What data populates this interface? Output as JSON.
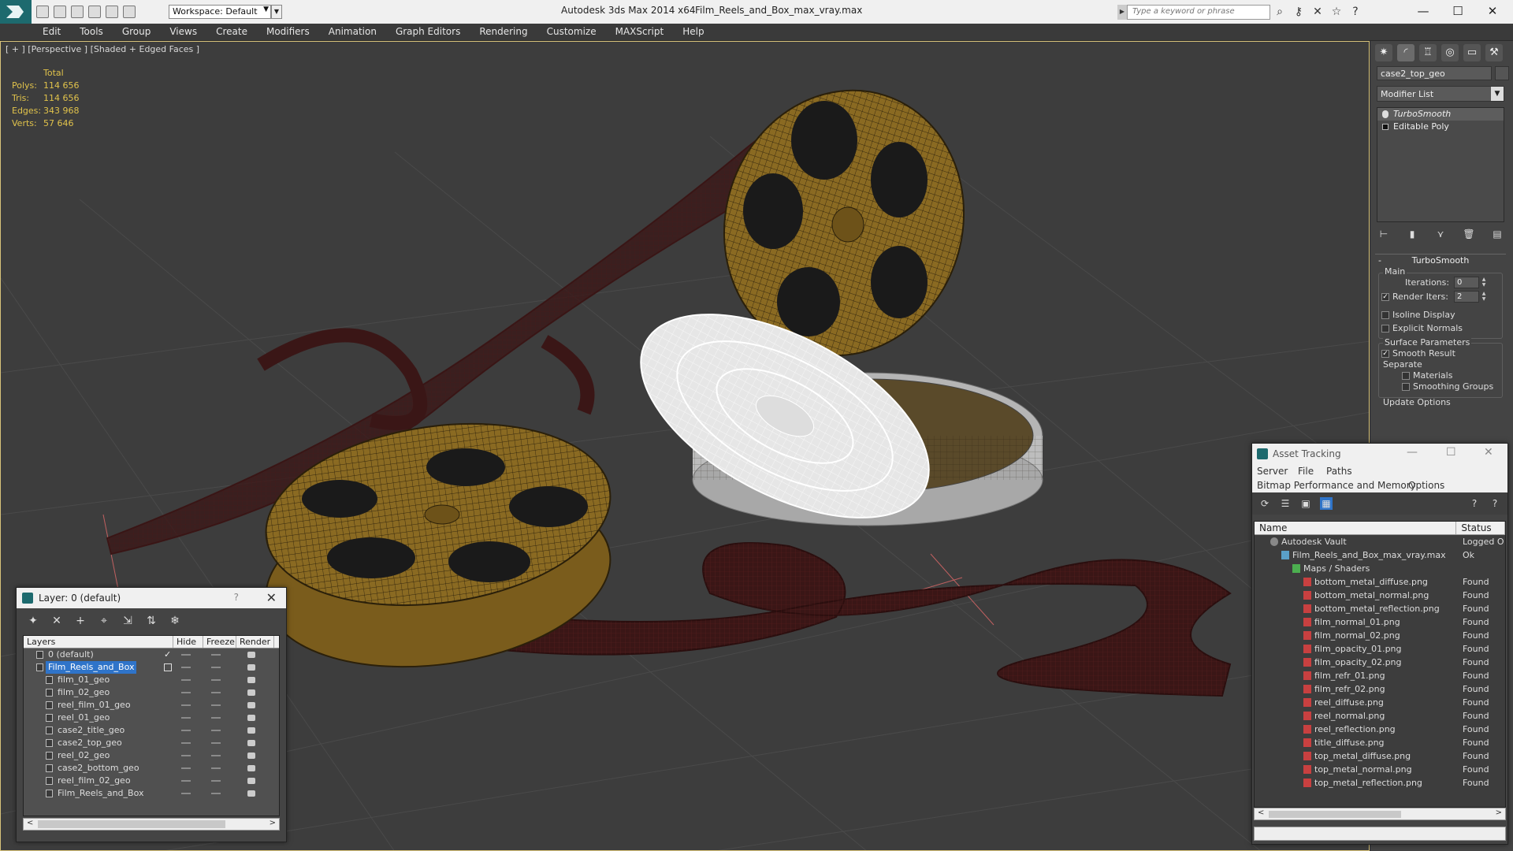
{
  "titlebar": {
    "workspace": "Workspace: Default",
    "app_name": "Autodesk 3ds Max  2014 x64",
    "file_name": "Film_Reels_and_Box_max_vray.max",
    "search_placeholder": "Type a keyword or phrase"
  },
  "menu": [
    "Edit",
    "Tools",
    "Group",
    "Views",
    "Create",
    "Modifiers",
    "Animation",
    "Graph Editors",
    "Rendering",
    "Customize",
    "MAXScript",
    "Help"
  ],
  "viewport": {
    "label": "[ + ] [Perspective ] [Shaded + Edged Faces ]",
    "stats": {
      "header": "Total",
      "rows": [
        {
          "label": "Polys:",
          "value": "114 656"
        },
        {
          "label": "Tris:",
          "value": "114 656"
        },
        {
          "label": "Edges:",
          "value": "343 968"
        },
        {
          "label": "Verts:",
          "value": "57 646"
        }
      ]
    }
  },
  "command_panel": {
    "object_name": "case2_top_geo",
    "modifier_list": "Modifier List",
    "stack": [
      "TurboSmooth",
      "Editable Poly"
    ],
    "rollout_title": "TurboSmooth",
    "main_label": "Main",
    "iterations_label": "Iterations:",
    "iterations_value": "0",
    "render_iters_label": "Render Iters:",
    "render_iters_value": "2",
    "isoline_label": "Isoline Display",
    "explicit_normals_label": "Explicit Normals",
    "surface_params_label": "Surface Parameters",
    "smooth_result_label": "Smooth Result",
    "separate_label": "Separate",
    "materials_label": "Materials",
    "smoothing_groups_label": "Smoothing Groups",
    "update_options_label": "Update Options"
  },
  "layer_dialog": {
    "title": "Layer: 0 (default)",
    "help": "?",
    "columns": [
      "Layers",
      "Hide",
      "Freeze",
      "Render"
    ],
    "rows": [
      {
        "name": "0 (default)",
        "indent": 1,
        "selected": false,
        "checked": true
      },
      {
        "name": "Film_Reels_and_Box",
        "indent": 1,
        "selected": true,
        "checked": false
      },
      {
        "name": "film_01_geo",
        "indent": 2,
        "selected": false,
        "checked": false
      },
      {
        "name": "film_02_geo",
        "indent": 2,
        "selected": false,
        "checked": false
      },
      {
        "name": "reel_film_01_geo",
        "indent": 2,
        "selected": false,
        "checked": false
      },
      {
        "name": "reel_01_geo",
        "indent": 2,
        "selected": false,
        "checked": false
      },
      {
        "name": "case2_title_geo",
        "indent": 2,
        "selected": false,
        "checked": false
      },
      {
        "name": "case2_top_geo",
        "indent": 2,
        "selected": false,
        "checked": false
      },
      {
        "name": "reel_02_geo",
        "indent": 2,
        "selected": false,
        "checked": false
      },
      {
        "name": "case2_bottom_geo",
        "indent": 2,
        "selected": false,
        "checked": false
      },
      {
        "name": "reel_film_02_geo",
        "indent": 2,
        "selected": false,
        "checked": false
      },
      {
        "name": "Film_Reels_and_Box",
        "indent": 2,
        "selected": false,
        "checked": false
      }
    ]
  },
  "asset_dialog": {
    "title": "Asset Tracking",
    "menu1": [
      "Server",
      "File",
      "Paths"
    ],
    "menu2": [
      "Bitmap Performance and Memory",
      "Options"
    ],
    "columns": [
      "Name",
      "Status"
    ],
    "rows": [
      {
        "name": "Autodesk Vault",
        "status": "Logged O",
        "indent": 1,
        "icon": "vault"
      },
      {
        "name": "Film_Reels_and_Box_max_vray.max",
        "status": "Ok",
        "indent": 2,
        "icon": "max"
      },
      {
        "name": "Maps / Shaders",
        "status": "",
        "indent": 3,
        "icon": "maps"
      },
      {
        "name": "bottom_metal_diffuse.png",
        "status": "Found",
        "indent": 4,
        "icon": "png"
      },
      {
        "name": "bottom_metal_normal.png",
        "status": "Found",
        "indent": 4,
        "icon": "png"
      },
      {
        "name": "bottom_metal_reflection.png",
        "status": "Found",
        "indent": 4,
        "icon": "png"
      },
      {
        "name": "film_normal_01.png",
        "status": "Found",
        "indent": 4,
        "icon": "png"
      },
      {
        "name": "film_normal_02.png",
        "status": "Found",
        "indent": 4,
        "icon": "png"
      },
      {
        "name": "film_opacity_01.png",
        "status": "Found",
        "indent": 4,
        "icon": "png"
      },
      {
        "name": "film_opacity_02.png",
        "status": "Found",
        "indent": 4,
        "icon": "png"
      },
      {
        "name": "film_refr_01.png",
        "status": "Found",
        "indent": 4,
        "icon": "png"
      },
      {
        "name": "film_refr_02.png",
        "status": "Found",
        "indent": 4,
        "icon": "png"
      },
      {
        "name": "reel_diffuse.png",
        "status": "Found",
        "indent": 4,
        "icon": "png"
      },
      {
        "name": "reel_normal.png",
        "status": "Found",
        "indent": 4,
        "icon": "png"
      },
      {
        "name": "reel_reflection.png",
        "status": "Found",
        "indent": 4,
        "icon": "png"
      },
      {
        "name": "title_diffuse.png",
        "status": "Found",
        "indent": 4,
        "icon": "png"
      },
      {
        "name": "top_metal_diffuse.png",
        "status": "Found",
        "indent": 4,
        "icon": "png"
      },
      {
        "name": "top_metal_normal.png",
        "status": "Found",
        "indent": 4,
        "icon": "png"
      },
      {
        "name": "top_metal_reflection.png",
        "status": "Found",
        "indent": 4,
        "icon": "png"
      }
    ]
  },
  "colors": {
    "viewport_bg": "#3d3d3d",
    "reel_gold": "#8a6a22",
    "film_red": "#3a1616",
    "stats_yellow": "#e0c24b",
    "selection_blue": "#2f74c9"
  }
}
